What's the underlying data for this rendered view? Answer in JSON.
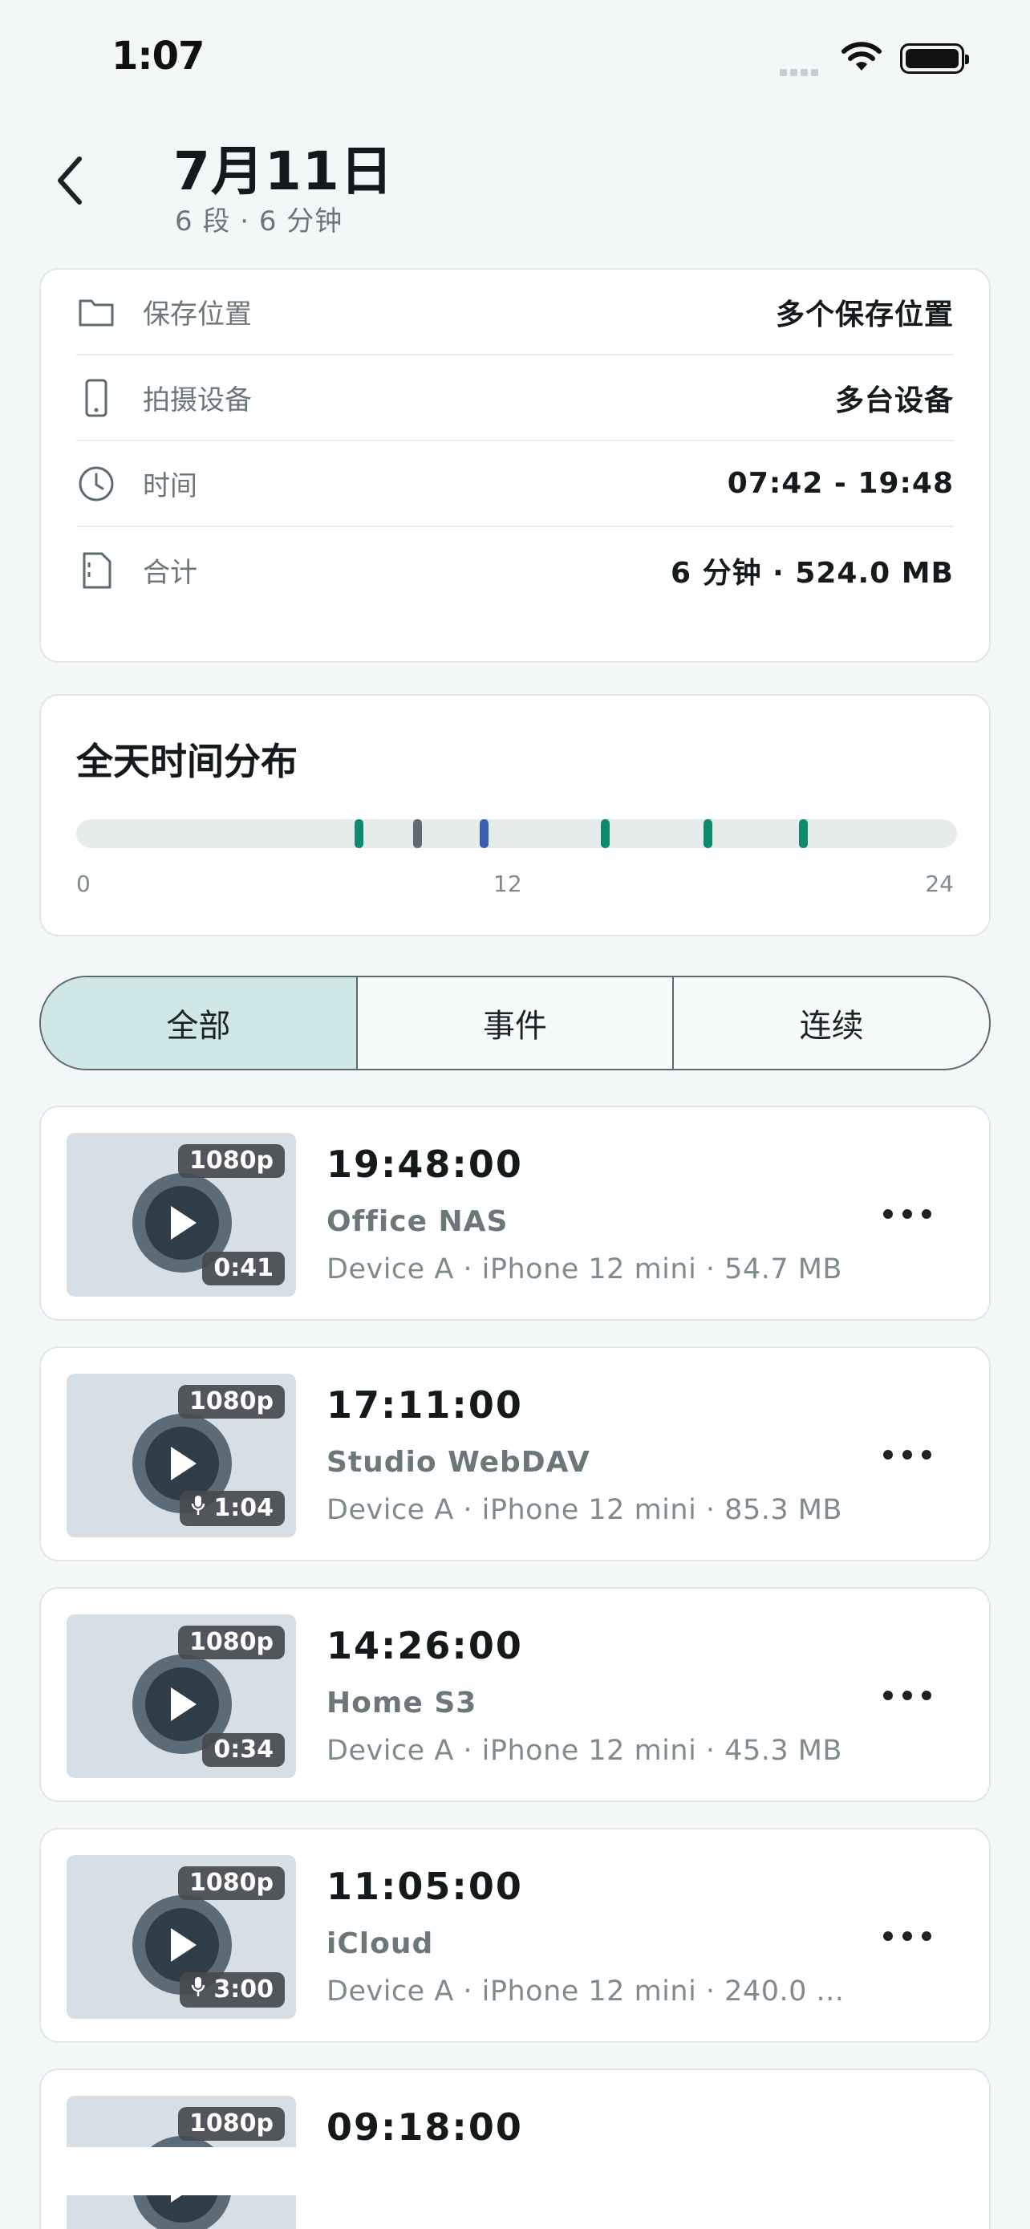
{
  "status_bar": {
    "time": "1:07"
  },
  "header": {
    "title": "7月11日",
    "subtitle": "6 段 · 6 分钟",
    "back_icon": "chevron-left-icon"
  },
  "info": [
    {
      "icon": "folder-icon",
      "label": "保存位置",
      "value": "多个保存位置"
    },
    {
      "icon": "phone-icon",
      "label": "拍摄设备",
      "value": "多台设备"
    },
    {
      "icon": "clock-icon",
      "label": "时间",
      "value": "07:42 - 19:48"
    },
    {
      "icon": "file-icon",
      "label": "合计",
      "value": "6 分钟 · 524.0 MB"
    }
  ],
  "distribution": {
    "title": "全天时间分布",
    "axis": [
      "0",
      "12",
      "24"
    ],
    "ticks": [
      {
        "hour": 7.7,
        "color": "#0f8a6c"
      },
      {
        "hour": 9.3,
        "color": "#5f6b73"
      },
      {
        "hour": 11.1,
        "color": "#3d5db0"
      },
      {
        "hour": 14.4,
        "color": "#0f8a6c"
      },
      {
        "hour": 17.2,
        "color": "#0f8a6c"
      },
      {
        "hour": 19.8,
        "color": "#0f8a6c"
      }
    ]
  },
  "tabs": {
    "all": "全部",
    "event": "事件",
    "continuous": "连续"
  },
  "items": [
    {
      "time": "19:48:00",
      "location": "Office NAS",
      "meta": "Device A · iPhone 12 mini · 54.7 MB",
      "resolution": "1080p",
      "duration": "0:41",
      "mic": false
    },
    {
      "time": "17:11:00",
      "location": "Studio WebDAV",
      "meta": "Device A · iPhone 12 mini · 85.3 MB",
      "resolution": "1080p",
      "duration": "1:04",
      "mic": true
    },
    {
      "time": "14:26:00",
      "location": "Home S3",
      "meta": "Device A · iPhone 12 mini · 45.3 MB",
      "resolution": "1080p",
      "duration": "0:34",
      "mic": false
    },
    {
      "time": "11:05:00",
      "location": "iCloud",
      "meta": "Device A · iPhone 12 mini · 240.0 ...",
      "resolution": "1080p",
      "duration": "3:00",
      "mic": true
    },
    {
      "time": "09:18:00",
      "location": "",
      "meta": "",
      "resolution": "1080p",
      "duration": "",
      "mic": false
    }
  ]
}
